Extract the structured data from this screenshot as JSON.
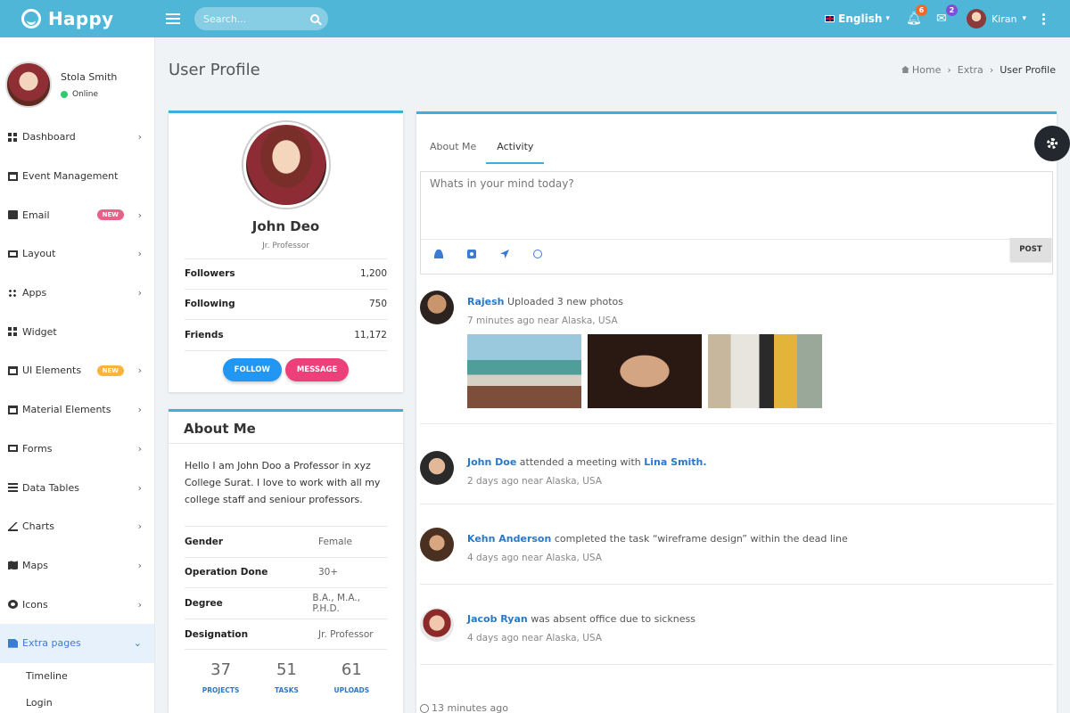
{
  "brand": {
    "name": "Happy"
  },
  "topbar": {
    "search_placeholder": "Search...",
    "language": "English",
    "notifications_count": "6",
    "messages_count": "2",
    "user_name": "Kiran",
    "colors": {
      "bar": "#4fb6d8",
      "notif_badge": "#f0692b",
      "msg_badge": "#7b4fd6"
    }
  },
  "sidebar": {
    "user_name": "Stola Smith",
    "status": "Online",
    "items": [
      {
        "label": "Dashboard",
        "icon": "grid-icon"
      },
      {
        "label": "Event Management",
        "icon": "calendar-icon"
      },
      {
        "label": "Email",
        "icon": "mail-icon",
        "badge": "NEW",
        "badge_color": "#ec5f86"
      },
      {
        "label": "Layout",
        "icon": "monitor-icon"
      },
      {
        "label": "Apps",
        "icon": "apps-icon"
      },
      {
        "label": "Widget",
        "icon": "widget-icon"
      },
      {
        "label": "UI Elements",
        "icon": "ui-icon",
        "badge": "NEW",
        "badge_color": "#f9b43b"
      },
      {
        "label": "Material Elements",
        "icon": "material-icon"
      },
      {
        "label": "Forms",
        "icon": "forms-icon"
      },
      {
        "label": "Data Tables",
        "icon": "table-icon"
      },
      {
        "label": "Charts",
        "icon": "chart-icon"
      },
      {
        "label": "Maps",
        "icon": "map-icon"
      },
      {
        "label": "Icons",
        "icon": "circle-icon"
      },
      {
        "label": "Extra pages",
        "icon": "file-icon"
      }
    ],
    "sub_items": [
      "Timeline",
      "Login"
    ]
  },
  "page": {
    "title": "User Profile",
    "breadcrumb": [
      "Home",
      "Extra",
      "User Profile"
    ]
  },
  "profile": {
    "name": "John Deo",
    "role": "Jr. Professor",
    "stats": [
      {
        "label": "Followers",
        "value": "1,200"
      },
      {
        "label": "Following",
        "value": "750"
      },
      {
        "label": "Friends",
        "value": "11,172"
      }
    ],
    "follow_label": "FOLLOW",
    "message_label": "MESSAGE"
  },
  "about": {
    "title": "About Me",
    "text": "Hello I am John Doo a Professor in xyz College Surat. I love to work with all my college staff and seniour professors.",
    "rows": [
      {
        "label": "Gender",
        "value": "Female"
      },
      {
        "label": "Operation Done",
        "value": "30+"
      },
      {
        "label": "Degree",
        "value": "B.A., M.A., P.H.D."
      },
      {
        "label": "Designation",
        "value": "Jr. Professor"
      }
    ],
    "counters": [
      {
        "value": "37",
        "label": "PROJECTS"
      },
      {
        "value": "51",
        "label": "TASKS"
      },
      {
        "value": "61",
        "label": "UPLOADS"
      }
    ]
  },
  "activity": {
    "tabs": [
      "About Me",
      "Activity"
    ],
    "active_tab": "Activity",
    "post_placeholder": "Whats in your mind today?",
    "post_label": "POST",
    "feed": [
      {
        "name": "Rajesh",
        "text": " Uploaded 3 new photos",
        "time": "7 minutes ago near Alaska, USA"
      },
      {
        "name": "John Doe",
        "text": " attended a meeting with ",
        "extra": "Lina Smith.",
        "time": "2 days ago near Alaska, USA"
      },
      {
        "name": "Kehn Anderson",
        "text": " completed the task “wireframe design” within the dead line",
        "time": "4 days ago near Alaska, USA"
      },
      {
        "name": "Jacob Ryan",
        "text": " was absent office due to sickness",
        "time": "4 days ago near Alaska, USA"
      }
    ],
    "last_time": "13 minutes ago"
  }
}
